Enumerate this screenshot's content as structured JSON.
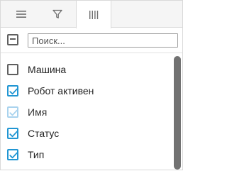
{
  "tabs": [
    {
      "id": "menu",
      "icon": "hamburger-menu-icon"
    },
    {
      "id": "filter",
      "icon": "filter-icon"
    },
    {
      "id": "columns",
      "icon": "columns-icon",
      "active": true
    }
  ],
  "search": {
    "placeholder": "Поиск...",
    "value": ""
  },
  "columns": [
    {
      "label": "Машина",
      "checked": false
    },
    {
      "label": "Робот активен",
      "checked": true
    },
    {
      "label": "Имя",
      "checked": true,
      "disabled": true
    },
    {
      "label": "Статус",
      "checked": true
    },
    {
      "label": "Тип",
      "checked": true
    }
  ],
  "colors": {
    "accent": "#2196d3",
    "accent_disabled": "#a9d3ee",
    "border": "#5f5f5f"
  }
}
